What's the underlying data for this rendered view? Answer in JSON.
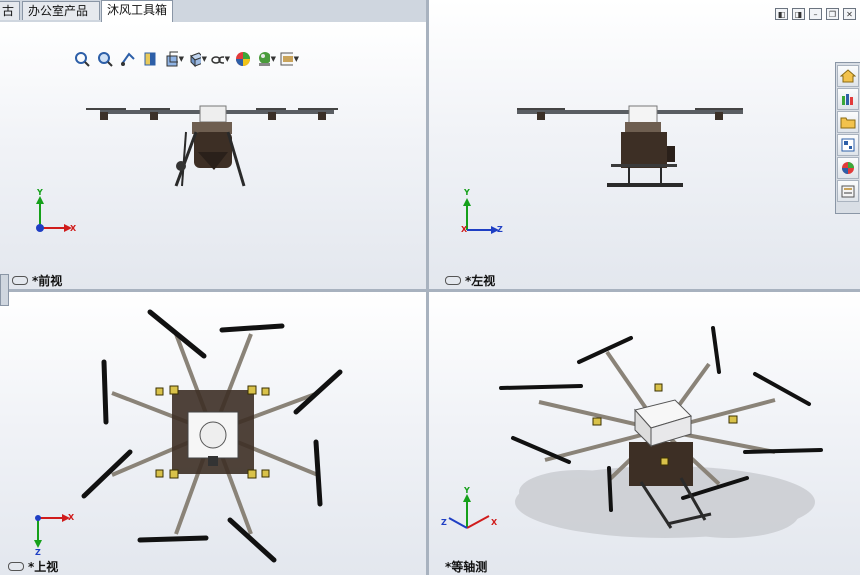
{
  "tabs": [
    {
      "label": "古"
    },
    {
      "label": "办公室产品"
    },
    {
      "label": "沐风工具箱"
    }
  ],
  "views": {
    "front": {
      "label": "*前视"
    },
    "left": {
      "label": "*左视"
    },
    "top": {
      "label": "*上视"
    },
    "iso": {
      "label": "*等轴测"
    }
  },
  "triad": {
    "x": "X",
    "y": "Y",
    "z": "Z"
  },
  "hud_tools": [
    "zoom-to-fit-icon",
    "zoom-area-icon",
    "previous-view-icon",
    "section-view-icon",
    "view-orientation-icon",
    "display-style-icon",
    "hide-show-items-icon",
    "edit-appearance-icon",
    "apply-scene-icon",
    "view-settings-icon"
  ],
  "taskpane_tools": [
    "solidworks-resources-icon",
    "design-library-icon",
    "file-explorer-icon",
    "view-palette-icon",
    "appearances-icon",
    "custom-properties-icon"
  ],
  "colors": {
    "accent": "#1a4f9c",
    "triad_x": "#d01c1c",
    "triad_y": "#15a01a",
    "triad_z": "#1f3fc4"
  }
}
